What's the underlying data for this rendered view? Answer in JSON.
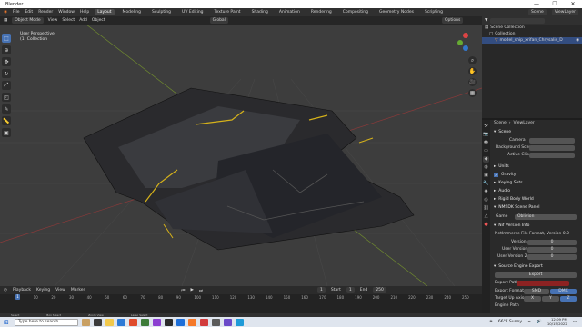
{
  "window": {
    "title": "Blender",
    "controls": [
      "—",
      "☐",
      "✕"
    ]
  },
  "menu": {
    "items": [
      "File",
      "Edit",
      "Render",
      "Window",
      "Help"
    ],
    "workspaces": [
      "Layout",
      "Modeling",
      "Sculpting",
      "UV Editing",
      "Texture Paint",
      "Shading",
      "Animation",
      "Rendering",
      "Compositing",
      "Geometry Nodes",
      "Scripting"
    ],
    "active_workspace": "Layout",
    "scene": "Scene",
    "view_layer": "ViewLayer"
  },
  "viewport_header": {
    "mode": "Object Mode",
    "menus": [
      "View",
      "Select",
      "Add",
      "Object"
    ],
    "orientation": "Global",
    "options": "Options"
  },
  "viewport": {
    "label_line1": "User Perspective",
    "label_line2": "(1) Collection"
  },
  "outliner": {
    "title": "Scene Collection",
    "rows": [
      "Collection",
      "model_ship_xrifan_Chrysalis_D"
    ]
  },
  "properties": {
    "breadcrumb_scene": "Scene",
    "breadcrumb_layer": "ViewLayer",
    "scene_section": "Scene",
    "camera_label": "Camera",
    "bg_scene_label": "Background Scene",
    "active_clip_label": "Active Clip",
    "units": "Units",
    "gravity": "Gravity",
    "keying_sets": "Keying Sets",
    "audio": "Audio",
    "rigid_body": "Rigid Body World",
    "nmsdk_panel": "NMSDK Scene Panel",
    "game_label": "Game",
    "game_value": "Oblivion",
    "nif_info": "Nif Version Info",
    "netimmerse_label": "NetImmerse File Format, Version 0.0",
    "version_label": "Version",
    "version_value": "0",
    "user_version_label": "User Version",
    "user_version_value": "0",
    "user_version2_label": "User Version 2",
    "user_version2_value": "0",
    "source_engine": "Source Engine Export",
    "export_btn": "Export",
    "export_path_label": "Export Path",
    "export_format_label": "Export Format",
    "format_smd": "SMD",
    "format_dmx": "DMX",
    "target_up_label": "Target Up Axis",
    "axis_x": "X",
    "axis_y": "Y",
    "axis_z": "Z",
    "engine_path_label": "Engine Path"
  },
  "timeline": {
    "menus": [
      "Playback",
      "Keying",
      "View",
      "Marker"
    ],
    "current_frame": "1",
    "start_label": "Start",
    "start": "1",
    "end_label": "End",
    "end": "250",
    "ticks": [
      "1",
      "10",
      "20",
      "30",
      "40",
      "50",
      "60",
      "70",
      "80",
      "90",
      "100",
      "110",
      "120",
      "130",
      "140",
      "150",
      "160",
      "170",
      "180",
      "190",
      "200",
      "210",
      "220",
      "230",
      "240",
      "250"
    ]
  },
  "status": {
    "left": "Select",
    "mid1": "Box Select",
    "mid2": "Zoom View",
    "mid3": "Lasso Select"
  },
  "taskbar": {
    "search_placeholder": "Type here to search",
    "weather": "66°F Sunny",
    "time": "12:09 PM",
    "date": "10/15/2022"
  },
  "colors": {
    "accent": "#4772b3",
    "hull": "#2a2a2d",
    "stripe": "#d6b21a"
  }
}
